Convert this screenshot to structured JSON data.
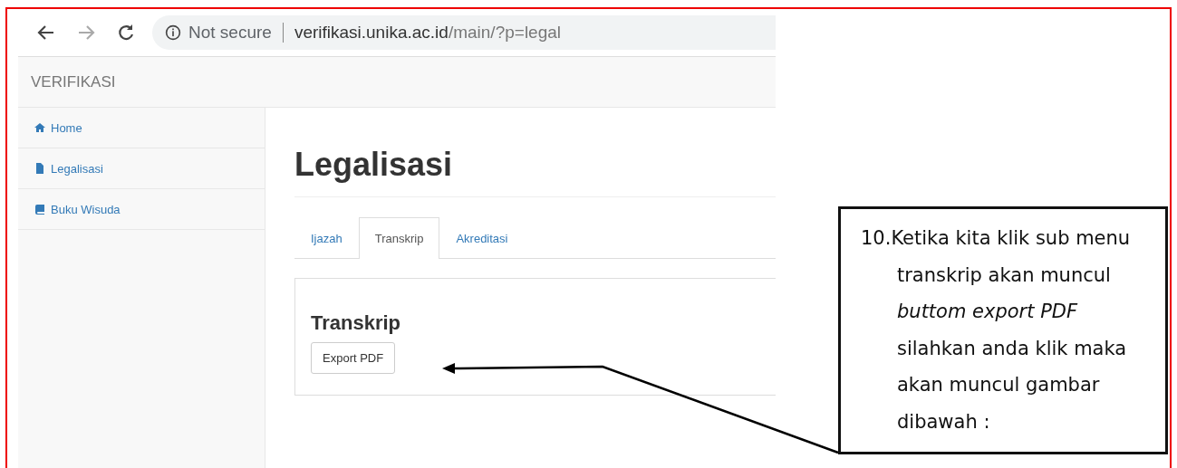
{
  "browser": {
    "security": "Not secure",
    "url_host": "verifikasi.unika.ac.id",
    "url_path": "/main/?p=legal"
  },
  "navbar": {
    "brand": "VERIFIKASI"
  },
  "sidebar": {
    "items": [
      {
        "label": "Home",
        "kind": "home"
      },
      {
        "label": "Legalisasi",
        "kind": "file"
      },
      {
        "label": "Buku Wisuda",
        "kind": "book"
      }
    ]
  },
  "page": {
    "title": "Legalisasi",
    "tabs": [
      {
        "label": "Ijazah",
        "selected": false
      },
      {
        "label": "Transkrip",
        "selected": true
      },
      {
        "label": "Akreditasi",
        "selected": false
      }
    ],
    "panel": {
      "heading": "Transkrip",
      "button": "Export PDF"
    }
  },
  "annotation": {
    "text": "10.Ketika kita klik sub menu transkrip akan muncul *buttom export PDF* silahkan anda klik maka akan muncul gambar dibawah :"
  }
}
